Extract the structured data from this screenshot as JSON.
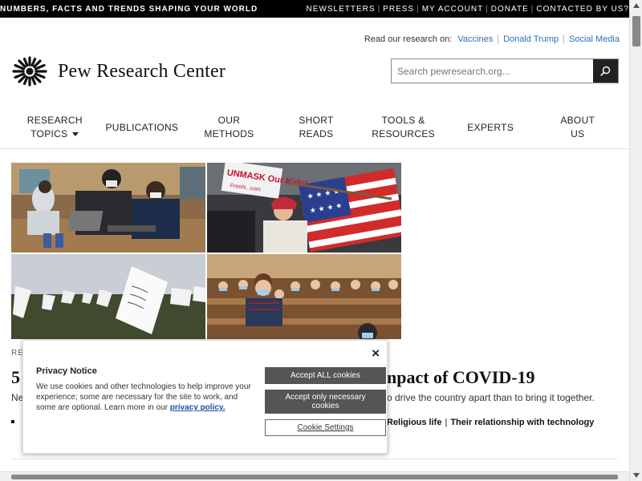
{
  "topbar": {
    "tagline": "NUMBERS, FACTS AND TRENDS SHAPING YOUR WORLD",
    "links": [
      "NEWSLETTERS",
      "PRESS",
      "MY ACCOUNT",
      "DONATE",
      "CONTACTED BY US?"
    ]
  },
  "research_on": {
    "label": "Read our research on:",
    "topics": [
      "Vaccines",
      "Donald Trump",
      "Social Media"
    ]
  },
  "logo": {
    "name": "Pew Research Center"
  },
  "search": {
    "placeholder": "Search pewresearch.org..."
  },
  "nav": [
    {
      "line1": "RESEARCH",
      "line2": "TOPICS"
    },
    {
      "line1": "PUBLICATIONS",
      "line2": ""
    },
    {
      "line1": "OUR",
      "line2": "METHODS"
    },
    {
      "line1": "SHORT",
      "line2": "READS"
    },
    {
      "line1": "TOOLS &",
      "line2": "RESOURCES"
    },
    {
      "line1": "EXPERTS",
      "line2": ""
    },
    {
      "line1": "ABOUT",
      "line2": "US"
    }
  ],
  "feature": {
    "eyebrow": "RE",
    "headline_start": "5",
    "headline_end": "npact of COVID-19",
    "dek_start": "Ne",
    "dek_end": "o drive the country apart than to bring it together.",
    "related": [
      "Religious life",
      "Their relationship with technology"
    ],
    "image_sign": "UNMASK Our Kids!",
    "image_sign_small": "FreeN...com"
  },
  "privacy": {
    "title": "Privacy Notice",
    "text": "We use cookies and other technologies to help improve your experience; some are necessary for the site to work, and some are optional. Learn more in our",
    "link": "privacy policy.",
    "accept_all": "Accept ALL cookies",
    "accept_necessary": "Accept only necessary cookies",
    "settings": "Cookie Settings",
    "close": "×"
  },
  "colors": {
    "link": "#2a6ebb",
    "topbar": "#000000",
    "button_dark": "#555555"
  },
  "icons": [
    "search-icon",
    "close-icon",
    "chevron-down-icon",
    "pew-logo-icon"
  ]
}
